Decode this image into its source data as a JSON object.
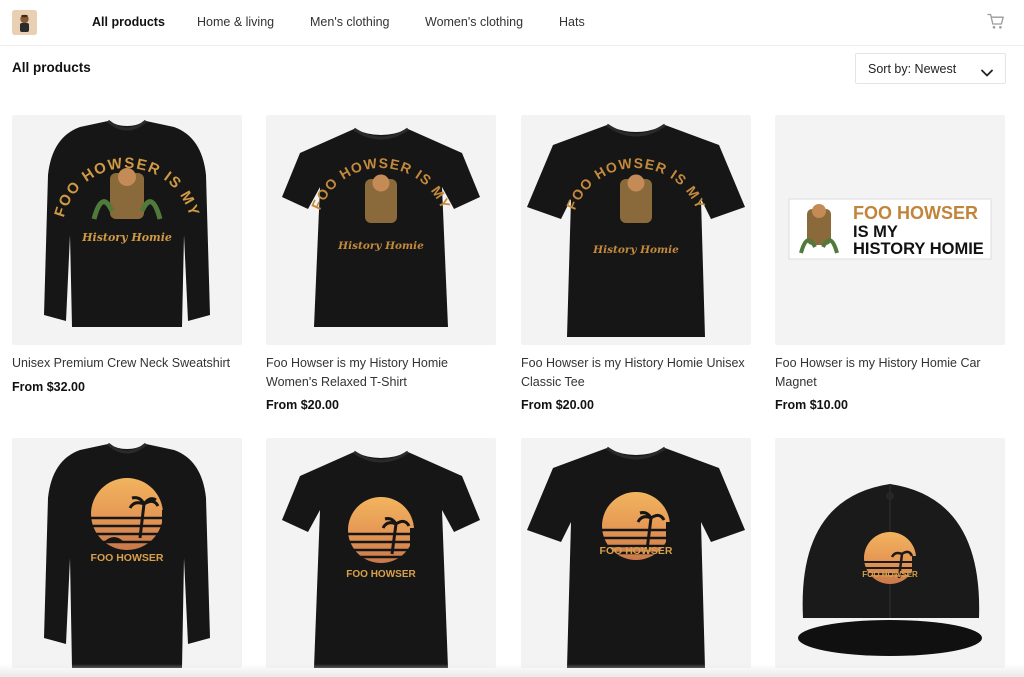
{
  "nav": {
    "items": [
      "All products",
      "Home & living",
      "Men's clothing",
      "Women's clothing",
      "Hats"
    ]
  },
  "page": {
    "title": "All products",
    "sort_label": "Sort by: Newest"
  },
  "products": [
    {
      "title": "Unisex Premium Crew Neck Sweatshirt",
      "price": "From $32.00",
      "image": "sweatshirt-history-homie"
    },
    {
      "title": "Foo Howser is my History Homie Women's Relaxed T-Shirt",
      "price": "From $20.00",
      "image": "womens-tee-history-homie"
    },
    {
      "title": "Foo Howser is my History Homie Unisex Classic Tee",
      "price": "From $20.00",
      "image": "classic-tee-history-homie"
    },
    {
      "title": "Foo Howser is my History Homie Car Magnet",
      "price": "From $10.00",
      "image": "car-magnet-history-homie"
    },
    {
      "title": "",
      "price": "",
      "image": "sweatshirt-sunset"
    },
    {
      "title": "",
      "price": "",
      "image": "womens-tee-sunset"
    },
    {
      "title": "",
      "price": "",
      "image": "classic-tee-sunset"
    },
    {
      "title": "",
      "price": "",
      "image": "cap-sunset"
    }
  ],
  "artwork": {
    "arc_text": "FOO HOWSER IS MY",
    "script_text": "History Homie",
    "magnet_lines": [
      "FOO HOWSER",
      "IS MY",
      "HISTORY HOMIE"
    ],
    "sunset_text": "FOO HOWSER"
  },
  "icons": {
    "logo": "avatar-logo",
    "cart": "shopping-cart-icon",
    "sort": "chevron-down-icon"
  },
  "colors": {
    "accent_text": "#111111",
    "card_bg": "#f3f3f3",
    "garment": "#161616",
    "print_gold": "#c48a3c"
  }
}
